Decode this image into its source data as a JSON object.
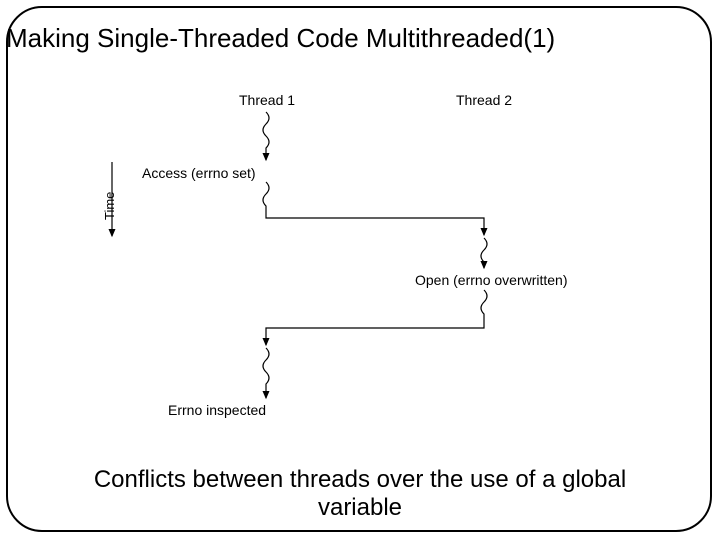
{
  "title": "Making Single-Threaded Code Multithreaded(1)",
  "caption_line1": "Conflicts between threads over the use of a global",
  "caption_line2": "variable",
  "diagram": {
    "time_axis_label": "Time",
    "thread1_label": "Thread 1",
    "thread2_label": "Thread 2",
    "event_access": "Access (errno set)",
    "event_open": "Open (errno overwritten)",
    "event_inspected": "Errno inspected"
  }
}
